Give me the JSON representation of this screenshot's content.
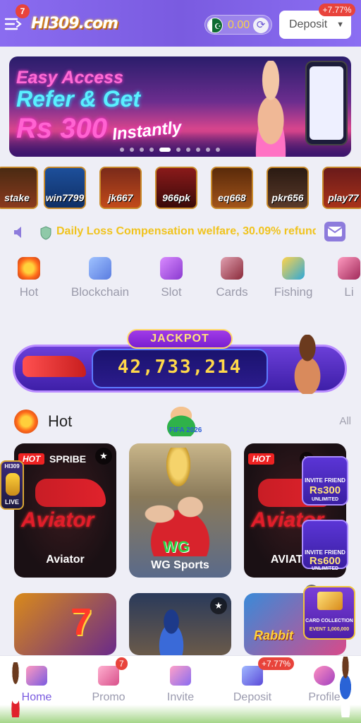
{
  "header": {
    "menu_badge": "7",
    "logo_text": "HI309.com",
    "balance": "0.00",
    "deposit_label": "Deposit",
    "deposit_bonus": "+7.77%"
  },
  "banner": {
    "line1": "Easy Access",
    "line2": "Refer & Get",
    "line3": "Rs 300",
    "line4": "Instantly",
    "slide_count": 10,
    "active_slide": 4
  },
  "providers": [
    {
      "label": "stake"
    },
    {
      "label": "win7799"
    },
    {
      "label": "jk667"
    },
    {
      "label": "966pk"
    },
    {
      "label": "eq668"
    },
    {
      "label": "pkr656"
    },
    {
      "label": "play77"
    }
  ],
  "notice": {
    "text": "Daily Loss Compensation welfare, 30.09% refund w"
  },
  "categories": [
    {
      "label": "Hot",
      "icon": "flame-icon",
      "color": "#ff6a1a"
    },
    {
      "label": "Blockchain",
      "icon": "blockchain-icon",
      "color": "#6f9cff"
    },
    {
      "label": "Slot",
      "icon": "slot-machine-icon",
      "color": "#b05ad8"
    },
    {
      "label": "Cards",
      "icon": "cards-icon",
      "color": "#b03a4a"
    },
    {
      "label": "Fishing",
      "icon": "fish-icon",
      "color": "#2fa8d8"
    },
    {
      "label": "Li",
      "icon": "live-icon",
      "color": "#d8507a"
    }
  ],
  "jackpot": {
    "title": "JACKPOT",
    "value": "42,733,214"
  },
  "hot_section": {
    "title": "Hot",
    "badge_text": "FIFA 2026",
    "all_label": "All"
  },
  "games": [
    {
      "label": "Aviator",
      "tag": "HOT",
      "provider": "SPRIBE",
      "art_text": "Aviator"
    },
    {
      "label": "WG Sports",
      "art_text": "WG"
    },
    {
      "label": "AVIATOR",
      "tag": "HOT",
      "art_text": "Aviator"
    },
    {
      "label": "",
      "art_text": "7"
    },
    {
      "label": "",
      "art_text": ""
    },
    {
      "label": "",
      "art_text": "Rabbit"
    }
  ],
  "floating": {
    "live_label": "LIVE",
    "live_brand": "HI309",
    "invite1_line1": "INVITE FRIEND",
    "invite1_amount": "Rs300",
    "invite1_line3": "UNLIMITED",
    "invite2_line1": "INVITE FRIEND",
    "invite2_amount": "Rs600",
    "invite2_line3": "UNLIMITED",
    "card_collection_line1": "CARD COLLECTION",
    "card_collection_line2": "EVENT 1,000,000"
  },
  "bottom_nav": {
    "items": [
      {
        "label": "Home",
        "icon": "home-icon"
      },
      {
        "label": "Promo",
        "icon": "gift-icon",
        "badge": "7"
      },
      {
        "label": "Invite",
        "icon": "share-icon"
      },
      {
        "label": "Deposit",
        "icon": "wallet-icon",
        "badge": "+7.77%"
      },
      {
        "label": "Profile",
        "icon": "profile-icon"
      }
    ]
  },
  "colors": {
    "header": "#8a6cf0",
    "accent": "#7a5be0",
    "notice_text": "#f0c31e",
    "badge": "#e8433b",
    "jackpot_value": "#ffd84a"
  }
}
